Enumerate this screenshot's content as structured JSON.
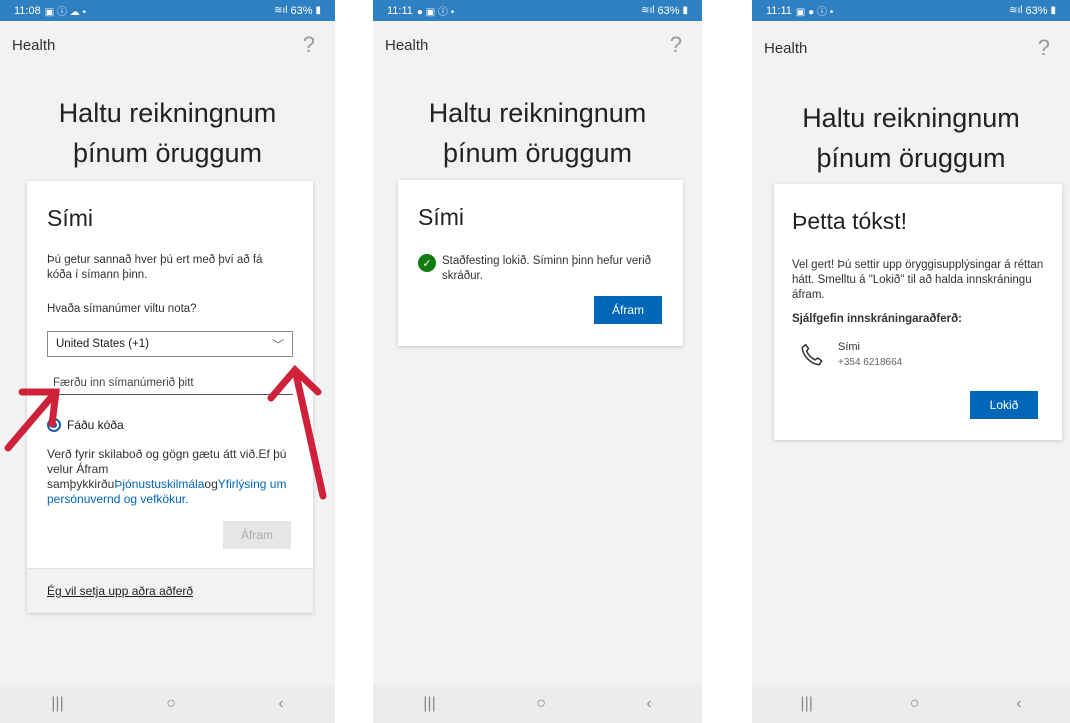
{
  "status": {
    "p1_time": "11:08",
    "p2_time": "11:11",
    "p3_time": "11:11",
    "battery": "63%"
  },
  "app": {
    "title": "Health",
    "help": "?"
  },
  "heading": "Haltu reikningnum þínum öruggum",
  "screen1": {
    "card_title": "Sími",
    "description": "Þú getur sannað hver þú ert með því að fá kóða í símann þinn.",
    "question": "Hvaða símanúmer viltu nota?",
    "country_select": "United States (+1)",
    "phone_placeholder": "Færðu inn símanúmerið þitt",
    "radio_label": "Fáðu kóða",
    "terms_prefix": "Verð fyrir skilaboð og gögn gætu átt við.Ef þú velur Áfram samþykkirðu",
    "terms_link": "Þjónustuskilmála",
    "terms_og": "og",
    "privacy_link": "Yfirlýsing um persónuvernd og vefkökur.",
    "next_button": "Áfram",
    "alt_method_link": "Ég vil setja upp aðra aðferð"
  },
  "screen2": {
    "card_title": "Sími",
    "status_text": "Staðfesting lokið. Síminn þinn hefur verið skráður.",
    "next_button": "Áfram"
  },
  "screen3": {
    "card_title": "Þetta tókst!",
    "message": "Vel gert! Þú settir upp öryggisupplýsingar á réttan hátt. Smelltu á \"Lokið\" til að halda innskráningu áfram.",
    "default_method_label": "Sjálfgefin innskráningaraðferð:",
    "method_name": "Sími",
    "method_number": "+354 6218664",
    "done_button": "Lokið"
  },
  "nav": {
    "recent": "|||",
    "home": "○",
    "back": "‹"
  },
  "colors": {
    "status_bar": "#2f7fc3",
    "primary": "#0067b8",
    "success": "#107c10",
    "annotation_arrow": "#d0213a"
  }
}
